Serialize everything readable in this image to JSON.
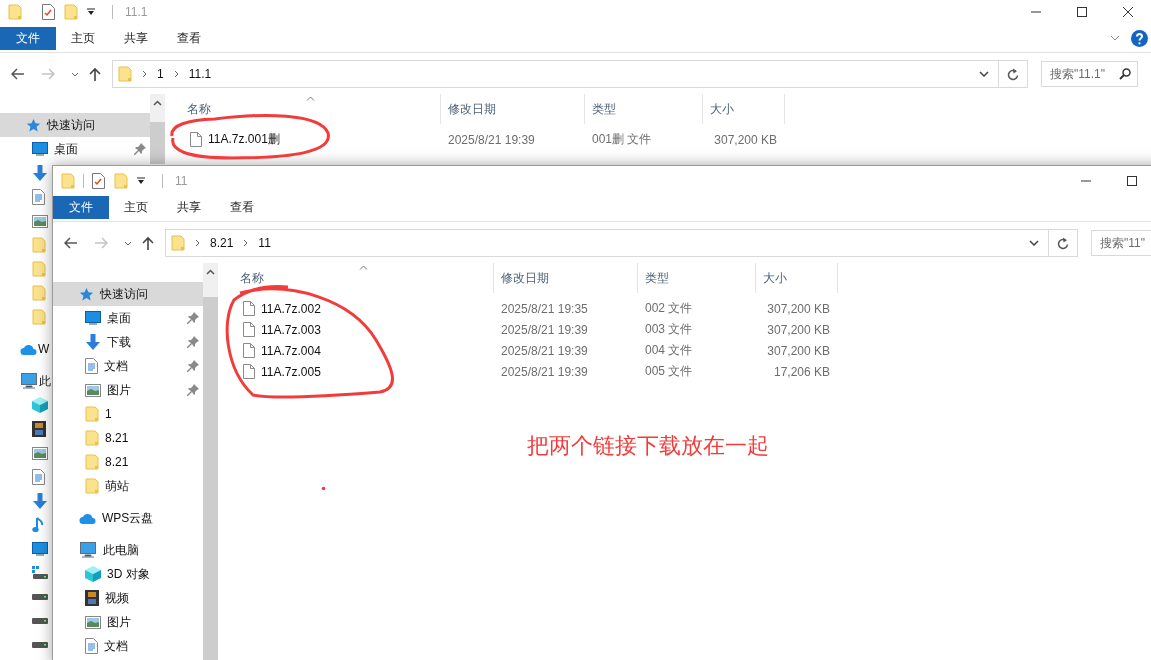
{
  "back_window": {
    "title": "11.1",
    "caption_buttons": [
      {
        "kind": "minimize"
      },
      {
        "kind": "maximize"
      },
      {
        "kind": "close"
      }
    ],
    "ribbon_tabs": [
      {
        "label": "文件",
        "selected": true
      },
      {
        "label": "主页",
        "selected": false
      },
      {
        "label": "共享",
        "selected": false
      },
      {
        "label": "查看",
        "selected": false
      }
    ],
    "ribbon_help": true,
    "address": [
      "1",
      "11.1"
    ],
    "search": {
      "placeholder": "搜索\"11.1\""
    },
    "sidebar": [
      {
        "kind": "quick",
        "label": "快速访问",
        "selected": true,
        "children": [
          {
            "kind": "desktop",
            "label": "桌面",
            "selected": false,
            "pinned": true
          },
          {
            "kind": "download",
            "selected": false
          },
          {
            "kind": "document",
            "selected": false
          },
          {
            "kind": "picture",
            "selected": false
          },
          {
            "kind": "folder",
            "selected": false
          },
          {
            "kind": "folder",
            "selected": false
          },
          {
            "kind": "folder",
            "selected": false
          },
          {
            "kind": "folder",
            "selected": false
          }
        ]
      },
      {
        "kind": "cloud",
        "label": "W",
        "selected": false
      },
      {
        "kind": "pc",
        "label": "此",
        "selected": false,
        "children": [
          {
            "kind": "cube",
            "selected": false
          },
          {
            "kind": "video",
            "selected": false
          },
          {
            "kind": "picture",
            "selected": false
          },
          {
            "kind": "document",
            "selected": false
          },
          {
            "kind": "download",
            "selected": false
          },
          {
            "kind": "music",
            "selected": false
          },
          {
            "kind": "desktop",
            "selected": false
          },
          {
            "kind": "windrive",
            "selected": false
          },
          {
            "kind": "drive",
            "selected": false
          },
          {
            "kind": "drive",
            "selected": false
          },
          {
            "kind": "drive",
            "selected": false
          }
        ]
      }
    ],
    "columns": [
      "名称",
      "修改日期",
      "类型",
      "大小"
    ],
    "files": [
      {
        "name": "11A.7z.001删",
        "modified": "2025/8/21 19:39",
        "type": "001删 文件",
        "size": "307,200 KB"
      }
    ]
  },
  "front_window": {
    "title": "11",
    "caption_buttons": [
      {
        "kind": "minimize"
      },
      {
        "kind": "maximize"
      }
    ],
    "ribbon_tabs": [
      {
        "label": "文件",
        "selected": true
      },
      {
        "label": "主页",
        "selected": false
      },
      {
        "label": "共享",
        "selected": false
      },
      {
        "label": "查看",
        "selected": false
      }
    ],
    "ribbon_help": false,
    "address": [
      "8.21",
      "11"
    ],
    "search": {
      "placeholder": "搜索\"11\""
    },
    "sidebar": [
      {
        "kind": "quick",
        "label": "快速访问",
        "selected": true,
        "children": [
          {
            "kind": "desktop",
            "label": "桌面",
            "selected": false,
            "pinned": true
          },
          {
            "kind": "download",
            "label": "下载",
            "selected": false,
            "pinned": true
          },
          {
            "kind": "document",
            "label": "文档",
            "selected": false,
            "pinned": true
          },
          {
            "kind": "picture",
            "label": "图片",
            "selected": false,
            "pinned": true
          },
          {
            "kind": "folder",
            "label": "1",
            "selected": false,
            "pinned": false
          },
          {
            "kind": "folder",
            "label": "8.21",
            "selected": false,
            "pinned": false
          },
          {
            "kind": "folder",
            "label": "8.21",
            "selected": false,
            "pinned": false
          },
          {
            "kind": "folder",
            "label": "萌站",
            "selected": false,
            "pinned": false
          }
        ]
      },
      {
        "kind": "cloud",
        "label": "WPS云盘",
        "selected": false
      },
      {
        "kind": "pc",
        "label": "此电脑",
        "selected": false,
        "children": [
          {
            "kind": "cube",
            "label": "3D 对象",
            "selected": false
          },
          {
            "kind": "video",
            "label": "视频",
            "selected": false
          },
          {
            "kind": "picture",
            "label": "图片",
            "selected": false
          },
          {
            "kind": "document",
            "label": "文档",
            "selected": false
          }
        ]
      }
    ],
    "columns": [
      "名称",
      "修改日期",
      "类型",
      "大小"
    ],
    "files": [
      {
        "name": "11A.7z.002",
        "modified": "2025/8/21 19:35",
        "type": "002 文件",
        "size": "307,200 KB"
      },
      {
        "name": "11A.7z.003",
        "modified": "2025/8/21 19:39",
        "type": "003 文件",
        "size": "307,200 KB"
      },
      {
        "name": "11A.7z.004",
        "modified": "2025/8/21 19:39",
        "type": "004 文件",
        "size": "307,200 KB"
      },
      {
        "name": "11A.7z.005",
        "modified": "2025/8/21 19:39",
        "type": "005 文件",
        "size": "17,206 KB"
      }
    ]
  },
  "annotation": {
    "text": "把两个链接下载放在一起"
  }
}
